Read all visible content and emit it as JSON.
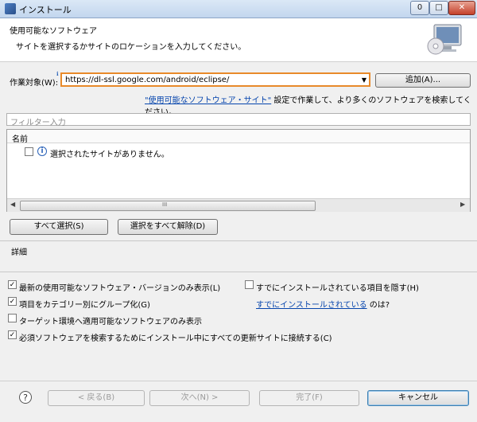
{
  "window": {
    "title": "インストール",
    "minimize": "0",
    "maximize": "□",
    "close": "✕"
  },
  "header": {
    "title": "使用可能なソフトウェア",
    "subtitle": "サイトを選択するかサイトのロケーションを入力してください。"
  },
  "work_target": {
    "label": "作業対象(W):",
    "value": "https://dl-ssl.google.com/android/eclipse/",
    "add_button": "追加(A)..."
  },
  "sites_line": {
    "link": "\"使用可能なソフトウェア・サイト\"",
    "text": " 設定で作業して、より多くのソフトウェアを検索してください。"
  },
  "filter": {
    "placeholder": "フィルター入力"
  },
  "tree": {
    "column_header": "名前",
    "items": [
      {
        "label": "選択されたサイトがありません。",
        "checked": false
      }
    ],
    "scroll_grip": "III"
  },
  "buttons": {
    "select_all": "すべて選択(S)",
    "deselect_all": "選択をすべて解除(D)"
  },
  "details": {
    "label": "詳細"
  },
  "options": {
    "latest_only": {
      "label": "最新の使用可能なソフトウェア・バージョンのみ表示(L)",
      "checked": true
    },
    "hide_installed": {
      "label": "すでにインストールされている項目を隠す(H)",
      "checked": false
    },
    "group_by_category": {
      "label": "項目をカテゴリー別にグループ化(G)",
      "checked": true
    },
    "already_installed_link": "すでにインストールされている",
    "already_installed_suffix": " のは?",
    "target_env_only": {
      "label": "ターゲット環境へ適用可能なソフトウェアのみ表示",
      "checked": false
    },
    "contact_all_sites": {
      "label": "必須ソフトウェアを検索するためにインストール中にすべての更新サイトに接続する(C)",
      "checked": true
    }
  },
  "footer": {
    "help": "?",
    "back": "< 戻る(B)",
    "next": "次へ(N) >",
    "finish": "完了(F)",
    "cancel": "キャンセル"
  }
}
